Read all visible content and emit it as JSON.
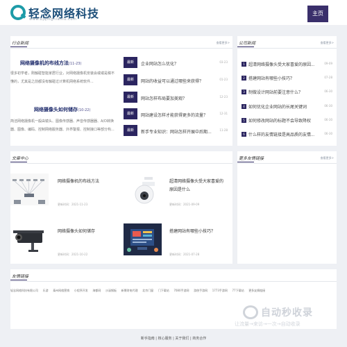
{
  "header": {
    "logo_name": "轻念网络科技",
    "logo_url": "www.bjqingnianlu.com",
    "home_label": "主页"
  },
  "industry": {
    "title": "行业新闻",
    "more": "查看更多>",
    "features": [
      {
        "title": "网络摄像机的布线方法",
        "date": "(11-23)",
        "text": "很多初学者，刚触碰智能家居行业，对网络摄像机安装会或或是稿不懂的，尤其是之前都没有触碰过计算机网络系统软件..."
      },
      {
        "title": "网络摄像头如何储存",
        "date": "(10-22)",
        "text": "简洁网络摄像机一般由镜头、图像传感器、声音传感器器、A/D转换器、图像、编码、控制网络服务器、外界警报、控制接口等部分构..."
      }
    ],
    "news": [
      {
        "tag": "最新",
        "title": "企业网站怎么优化？",
        "date": "03-23"
      },
      {
        "tag": "最新",
        "title": "网站的收益可以通过哪些来获得？",
        "date": "01-23"
      },
      {
        "tag": "最新",
        "title": "网站怎样布局要加美观？",
        "date": "12-23"
      },
      {
        "tag": "最新",
        "title": "网站建设怎样才能获得更多的流量？",
        "date": "12-31"
      },
      {
        "tag": "最新",
        "title": "新手专业知识：网站怎样开展中后期...",
        "date": "11-28"
      }
    ]
  },
  "company": {
    "title": "公司新闻",
    "more": "查看更多>",
    "items": [
      {
        "num": "1",
        "title": "超清网络摄像头受大家喜爱的原因...",
        "date": "09-09"
      },
      {
        "num": "2",
        "title": "搭建网站有哪些小技巧？",
        "date": "07-28"
      },
      {
        "num": "3",
        "title": "制做设计网站前要注意什么？",
        "date": "06-30"
      },
      {
        "num": "4",
        "title": "如何优化企业网站的长尾关键词",
        "date": "06-30"
      },
      {
        "num": "5",
        "title": "如何修改网站的标题不会导致降权",
        "date": "06-30"
      },
      {
        "num": "6",
        "title": "什么样的友情链接是高品质的友情...",
        "date": "06-30"
      }
    ]
  },
  "articles": {
    "title": "文章中心",
    "more": "查看更多>",
    "cards": [
      {
        "title": "网络摄像机的布线方法",
        "date": "更新时间：2021-11-23",
        "image": "camera-wiring-diagram"
      },
      {
        "title": "超清网络摄像头受大家喜爱的原因是什么",
        "date": "更新时间：2021-09-09",
        "image": "dome-camera"
      },
      {
        "title": "网络摄像头如何储存",
        "date": "更新时间：2021-10-22",
        "image": "bullet-camera"
      },
      {
        "title": "搭建网站有哪些小技巧？",
        "date": "更新时间：2021-07-28",
        "image": "website-design-illustration"
      }
    ]
  },
  "links": {
    "title": "更多友情链接",
    "more": "查看更多>",
    "friend_title": "友情链接",
    "items": [
      "轻念网络科技有限公司",
      "乐游",
      "泰州网络营销",
      "小程序开发",
      "海都网",
      "沙溪钢板",
      "新景财电代理",
      "北京门窗",
      "门下载站",
      "7080手游网",
      "游侠手游网",
      "1773手游网",
      "77下载站",
      "更多友情链接"
    ]
  },
  "footer": {
    "text": "新手指南 | 核心服务 | 关于我们 | 商务合作"
  },
  "watermark": {
    "name": "自动秒收录",
    "sub": "让流量→来访→一次→自动收录"
  }
}
